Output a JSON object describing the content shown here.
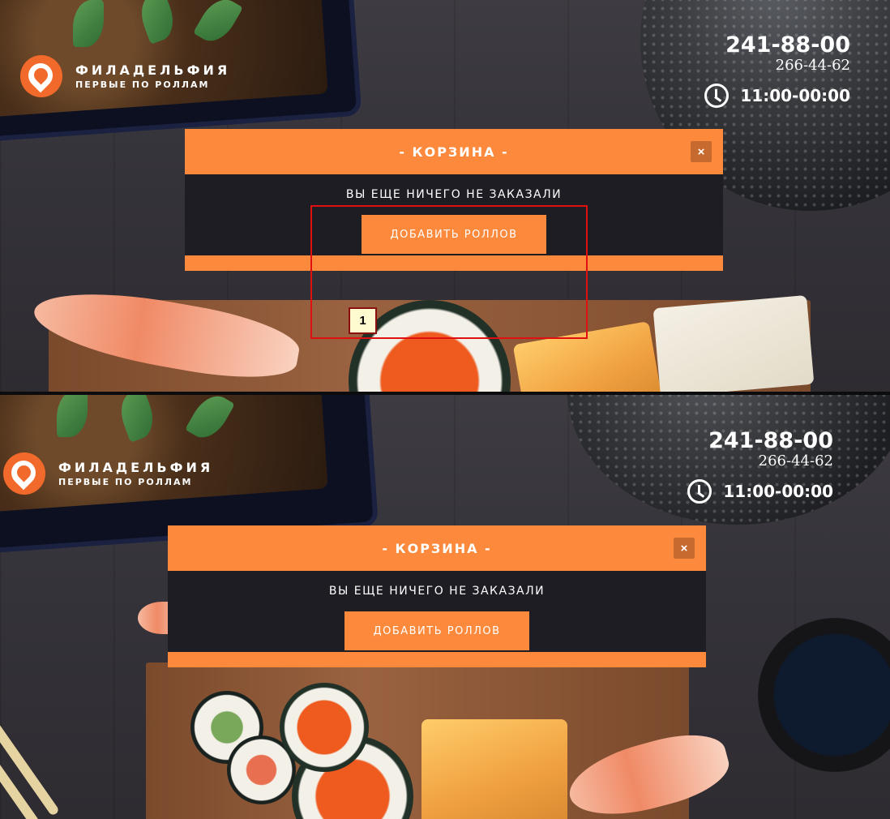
{
  "brand": {
    "name": "ФИЛАДЕЛЬФИЯ",
    "tagline": "ПЕРВЫЕ ПО РОЛЛАМ",
    "accent_color": "#fd8a3c",
    "logo_color": "#f26a2b"
  },
  "contact": {
    "phone_main": "241-88-00",
    "phone_alt": "266-44-62",
    "hours": "11:00-00:00",
    "hours_icon": "clock-icon"
  },
  "cart_modal": {
    "title": "- КОРЗИНА -",
    "close_label": "×",
    "empty_message": "ВЫ ЕЩЕ НИЧЕГО НЕ ЗАКАЗАЛИ",
    "add_button_label": "ДОБАВИТЬ РОЛЛОВ"
  },
  "annotation": {
    "marker_label": "1",
    "highlight_color": "#e01010"
  }
}
